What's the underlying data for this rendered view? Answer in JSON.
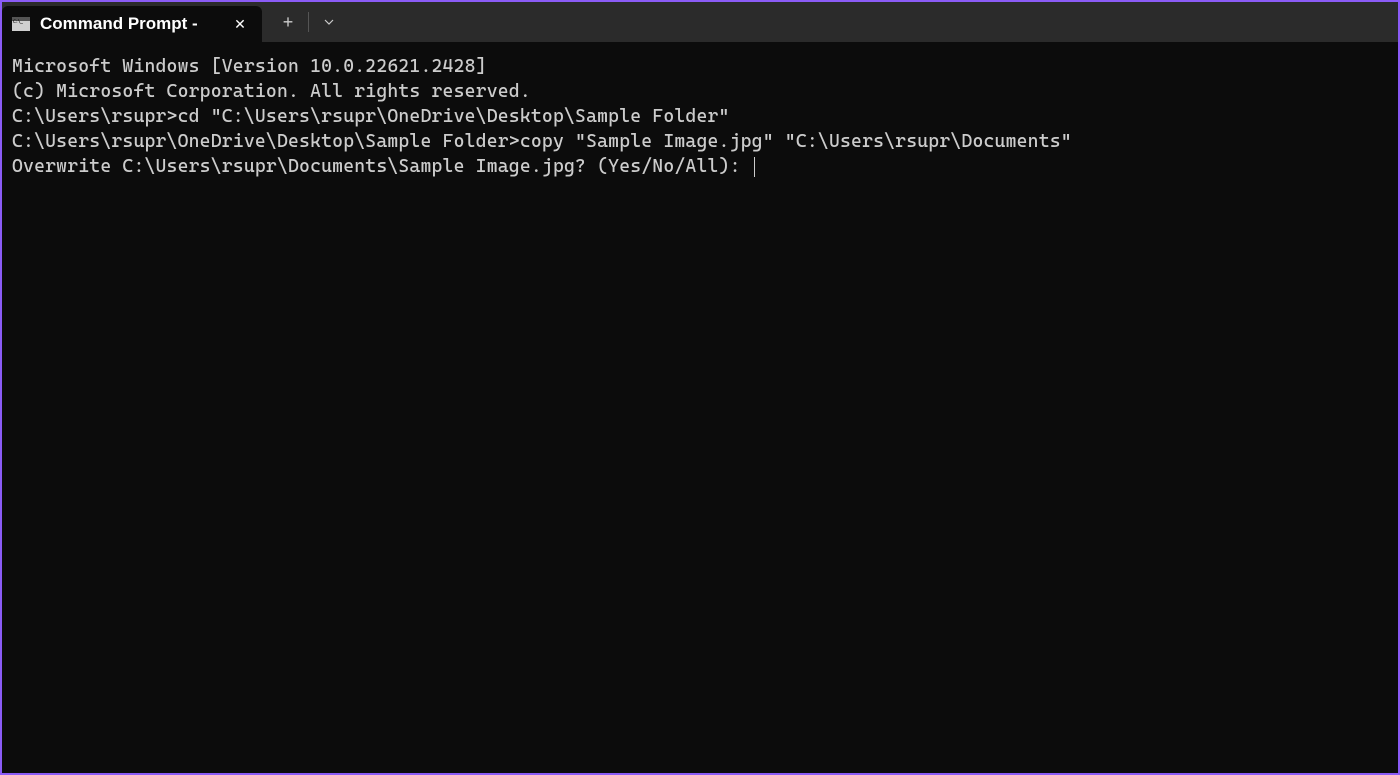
{
  "tab": {
    "title": "Command Prompt -"
  },
  "terminal": {
    "line1": "Microsoft Windows [Version 10.0.22621.2428]",
    "line2": "(c) Microsoft Corporation. All rights reserved.",
    "blank1": "",
    "line3": "C:\\Users\\rsupr>cd \"C:\\Users\\rsupr\\OneDrive\\Desktop\\Sample Folder\"",
    "blank2": "",
    "line4": "C:\\Users\\rsupr\\OneDrive\\Desktop\\Sample Folder>copy \"Sample Image.jpg\" \"C:\\Users\\rsupr\\Documents\"",
    "line5": "Overwrite C:\\Users\\rsupr\\Documents\\Sample Image.jpg? (Yes/No/All): "
  }
}
